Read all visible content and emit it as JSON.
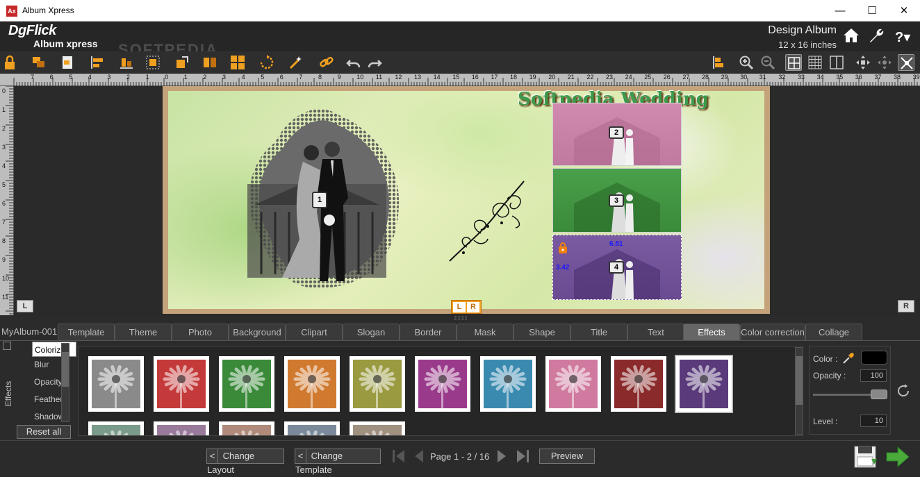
{
  "window": {
    "title": "Album Xpress",
    "app_icon": "Ax",
    "minimize": "—",
    "maximize": "☐",
    "close": "✕"
  },
  "header": {
    "logo_brand": "DgFlick",
    "logo_product": "Album xpress",
    "design_title": "Design Album",
    "size": "12 x 16 inches",
    "watermark": "SOFTPEDIA"
  },
  "rulers": {
    "horizontal": [
      "7",
      "6",
      "5",
      "4",
      "3",
      "2",
      "1",
      "0",
      "1",
      "2",
      "3",
      "4",
      "5",
      "6",
      "7",
      "8",
      "9",
      "10",
      "11",
      "12",
      "13",
      "14",
      "15",
      "16",
      "17",
      "18",
      "19",
      "20",
      "21",
      "22",
      "23",
      "24",
      "25",
      "26",
      "27",
      "28",
      "29",
      "30",
      "31",
      "32",
      "33",
      "34",
      "35",
      "36",
      "37",
      "38",
      "39"
    ],
    "vertical": [
      "0",
      "1",
      "2",
      "3",
      "4",
      "5",
      "6",
      "7",
      "8",
      "9",
      "10",
      "11"
    ]
  },
  "canvas": {
    "title_text": "Softpedia Wedding",
    "slots": [
      "1",
      "2",
      "3",
      "4"
    ],
    "dim_width": "6.81",
    "dim_height": "3.42",
    "left_marker": "L",
    "right_marker": "R",
    "lr_left": "L",
    "lr_right": "R"
  },
  "tabs": {
    "album_name": "MyAlbum-001",
    "items": [
      "Template",
      "Theme",
      "Photo",
      "Background",
      "Clipart",
      "Slogan",
      "Border",
      "Mask",
      "Shape",
      "Title",
      "Text",
      "Effects",
      "Color correction",
      "Collage"
    ],
    "active": "Effects"
  },
  "effects": {
    "panel_label": "Effects",
    "items": [
      "Colorize",
      "Blur",
      "Opacity",
      "Feather",
      "Shadow"
    ],
    "selected": "Colorize",
    "reset_label": "Reset all",
    "thumb_colors": [
      "#8a8a8a",
      "#c43a3a",
      "#3a8a3a",
      "#d07a30",
      "#9a9a40",
      "#9a3a8a",
      "#3a8ab0",
      "#d07aa0",
      "#8a2a2a",
      "#5a3a7a"
    ],
    "thumb_colors_row2": [
      "#7a9a8a",
      "#9a7a9a",
      "#b08a7a",
      "#7a8a9a",
      "#a09080"
    ],
    "color_label": "Color :",
    "color_value": "#000000",
    "opacity_label": "Opacity :",
    "opacity_value": "100",
    "level_label": "Level :",
    "level_value": "10"
  },
  "bottom": {
    "change_layout": "Change Layout",
    "change_template": "Change Template",
    "back_glyph": "<",
    "page_text": "Page 1 - 2 / 16",
    "preview": "Preview"
  }
}
